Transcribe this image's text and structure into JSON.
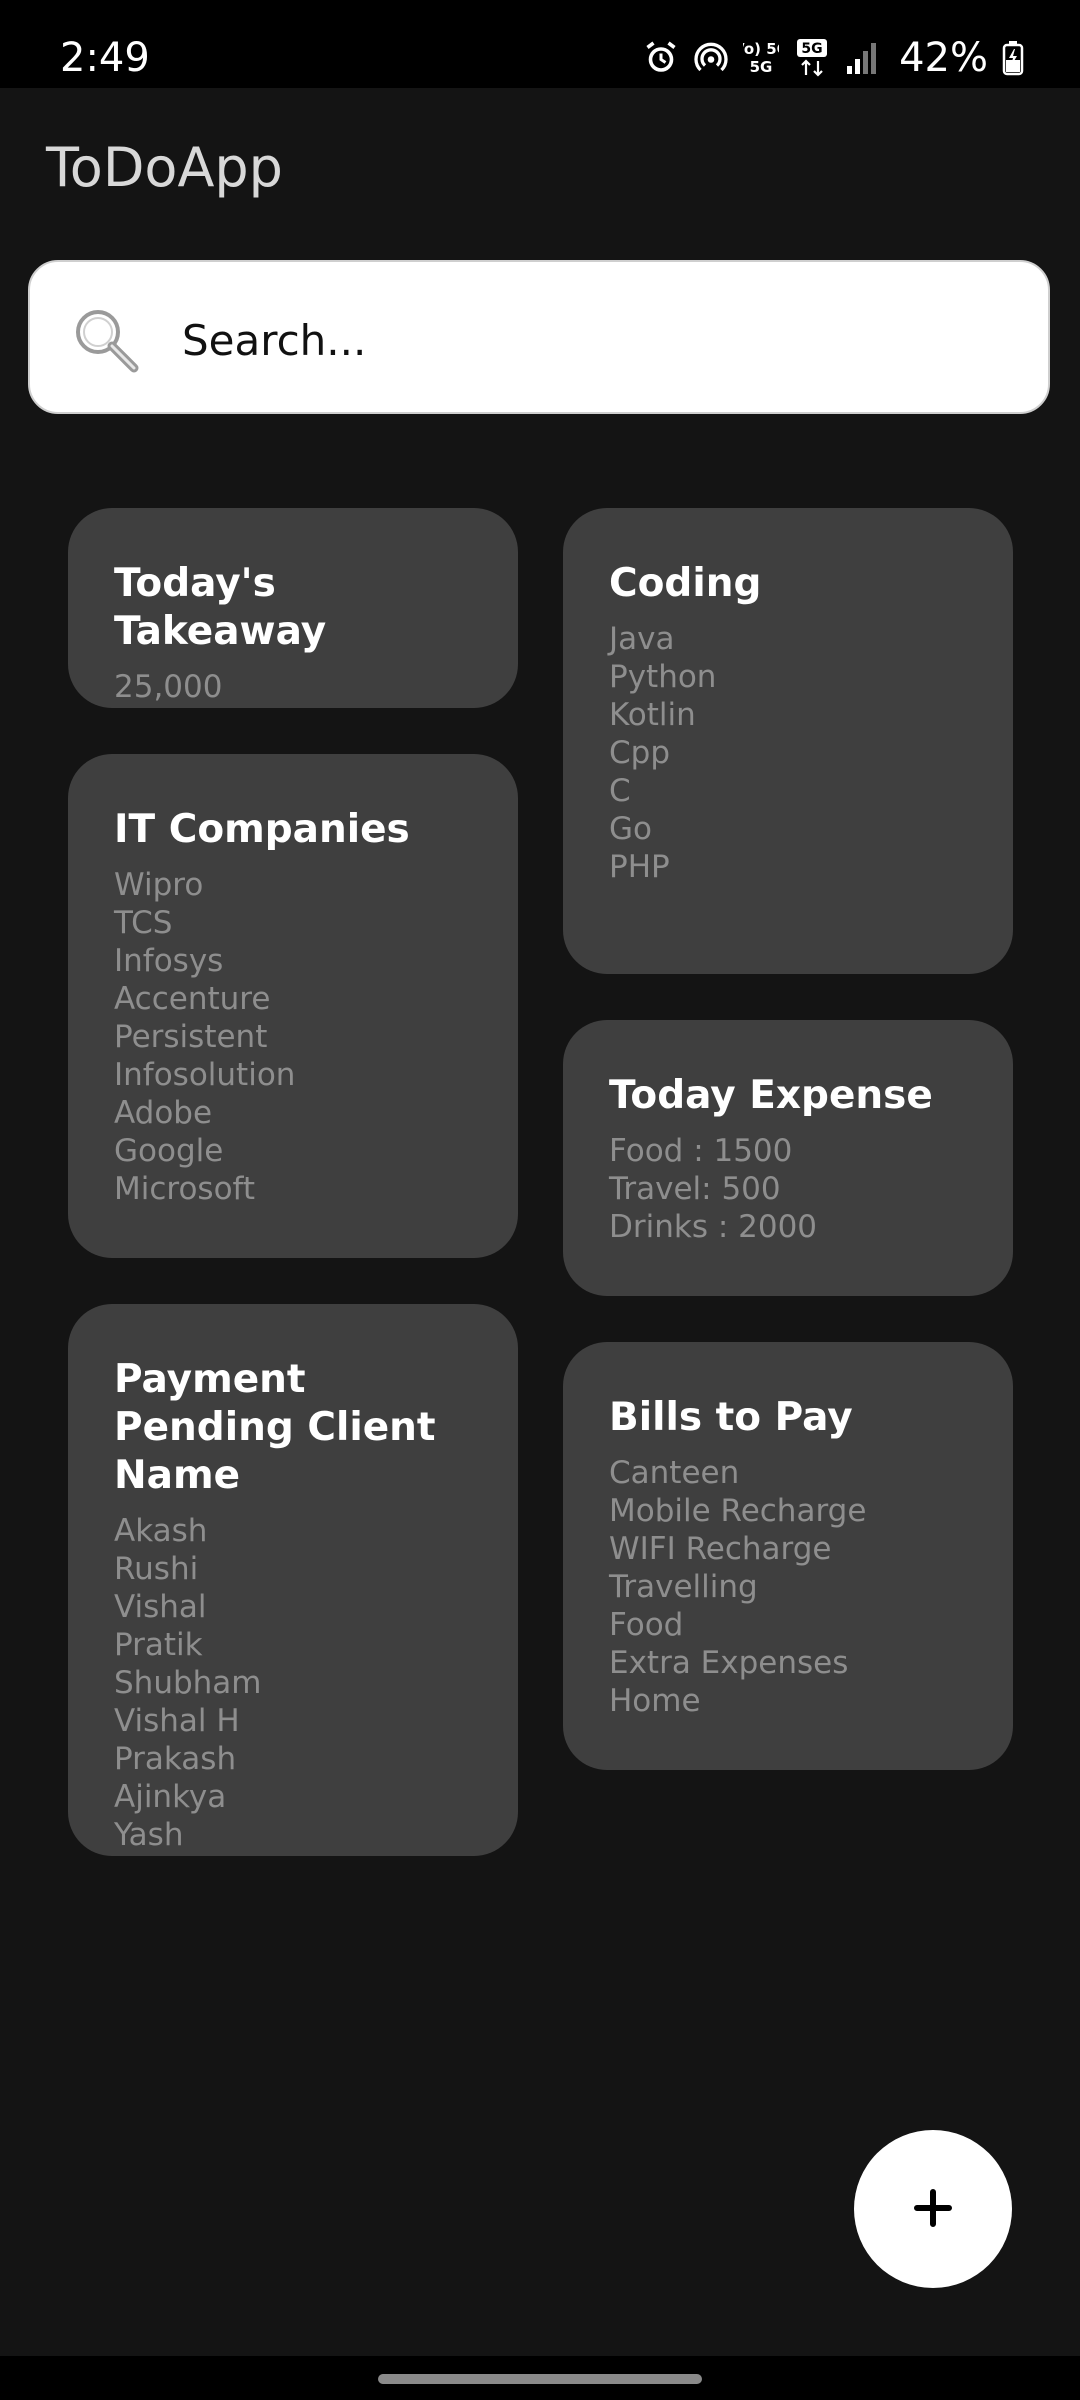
{
  "status_bar": {
    "time": "2:49",
    "network": "Vo) 5G",
    "network_type": "5G",
    "battery": "42%",
    "icons": [
      "alarm-icon",
      "hotspot-icon",
      "volte-icon",
      "5g-data-icon",
      "signal-icon",
      "battery-charging-icon"
    ]
  },
  "app": {
    "title": "ToDoApp"
  },
  "search": {
    "placeholder": "Search...",
    "value": ""
  },
  "notes": [
    {
      "title": "Today's Takeaway",
      "body": "25,000"
    },
    {
      "title": "IT Companies",
      "body": "Wipro\nTCS\nInfosys\nAccenture\nPersistent\nInfosolution\nAdobe\nGoogle\nMicrosoft"
    },
    {
      "title": "Payment Pending Client Name",
      "body": "Akash\nRushi\nVishal\nPratik\nShubham\nVishal H\nPrakash\nAjinkya\nYash"
    },
    {
      "title": "Coding",
      "body": "Java\nPython\nKotlin\nCpp\nC\nGo\nPHP"
    },
    {
      "title": "Today Expense",
      "body": "Food : 1500\nTravel: 500\nDrinks : 2000"
    },
    {
      "title": "Bills to Pay",
      "body": "Canteen\nMobile Recharge\nWIFI Recharge\nTravelling\nFood\nExtra Expenses\nHome"
    }
  ],
  "fab": {
    "icon": "plus-icon"
  },
  "colors": {
    "background": "#141414",
    "card": "#3f3f3f",
    "title_text": "#ffffff",
    "body_text": "#8e8e8e",
    "fab": "#ffffff"
  }
}
